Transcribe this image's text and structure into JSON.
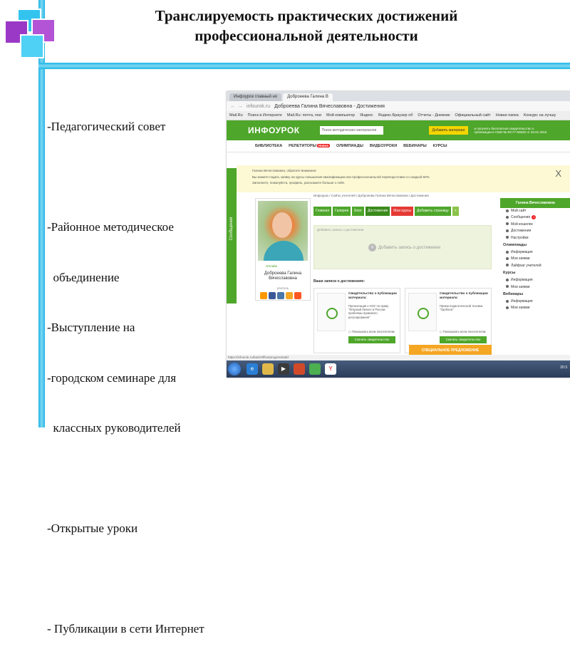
{
  "slide": {
    "title_line1": "Транслируемость практических достижений",
    "title_line2": "профессиональной деятельности",
    "bullets": [
      "-Педагогический совет",
      "",
      "-Районное методическое",
      "  объединение",
      "-Выступление на",
      "-городском семинаре для",
      "  классных руководителей",
      "",
      "-Открытые уроки",
      "",
      "- Публикации в сети Интернет"
    ]
  },
  "browser": {
    "tabs": [
      "Инфоурок главный но",
      "Доброеева Галина В"
    ],
    "url": "infourok.ru",
    "page_title": "Доброеева Галина Вячеславовна - Достижения",
    "bookmarks": [
      "Mail.Ru",
      "Поиск в Интернете",
      "Mail.Ru: почта, пои",
      "Мой компьютер",
      "Яндекс",
      "Яндекс.Браузер об",
      "Отчеты - Дневник",
      "Официальный сайт",
      "Новая папка",
      "Конкурс на лучшу"
    ]
  },
  "site": {
    "logo": "ИНФОУРОК",
    "search_placeholder": "Поиск методических материалов",
    "add_material_button": "Добавить материал",
    "promo_text": "и получить бесплатное свидетельство о публикации в СМИ № ФС77-60625 от 20.01.2015",
    "menu": [
      "БИБЛИОТЕКА",
      "РЕПЕТИТОРЫ",
      "ОЛИМПИАДЫ",
      "ВИДЕОУРОКИ",
      "ВЕБИНАРЫ",
      "КУРСЫ"
    ],
    "menu_badge": "Новое",
    "side_tab": "Сообщения",
    "notice_line1": "Галина Вячеславовна, обратите внимание:",
    "notice_line2": "Вы можете подать заявку на курсы повышения квалификации или профессиональной переподготовки со скидкой 50%",
    "notice_line3": "Заполните, пожалуйста, профиль, расскажите больше о себе.",
    "close": "X",
    "breadcrumb": "Инфоурок / Сайты учителей / Доброеева Галина Вячеславовна / Достижения",
    "profile": {
      "online": "Онлайн",
      "name": "Доброеева Галина Вячеславовна",
      "role": "учитель"
    },
    "page_buttons": [
      "Главная",
      "Галерея",
      "Блог",
      "Достижения",
      "Мои курсы",
      "Добавить страницу",
      "+"
    ],
    "add_label": "Добавить запись о достижении",
    "add_center": "Добавить запись о достижении",
    "section_title": "Ваши записи о достижениях:",
    "cards": [
      {
        "title": "Свидетельство о публикации материала:",
        "desc": "Презентация к НОУ по праву \"Игорный бизнес в России: проблемы правового регулирования\"",
        "show": "Показывать всем посетителям",
        "button": "Скачать свидетельство"
      },
      {
        "title": "Свидетельство о публикации материала:",
        "desc": "Прием педагогической техники \"Удобона\"",
        "show": "Показывать всем посетителям",
        "button": "Скачать свидетельство"
      }
    ],
    "special_offer": "СПЕЦИАЛЬНОЕ ПРЕДЛОЖЕНИЕ",
    "right_head": "Галина Вячеславовна",
    "right_items": [
      {
        "label": "Мой сайт"
      },
      {
        "label": "Сообщения",
        "badge": "1"
      },
      {
        "label": "Мой кошелек"
      },
      {
        "label": "Достижения"
      },
      {
        "label": "Настройки"
      }
    ],
    "right_sections": [
      {
        "title": "Олимпиады",
        "items": [
          "Информация",
          "Мои заявки",
          "Лайфхаг учителей"
        ]
      },
      {
        "title": "Курсы",
        "items": [
          "Информация",
          "Мои заявки"
        ]
      },
      {
        "title": "Вебинары",
        "items": [
          "Информация",
          "Мои заявки"
        ]
      }
    ],
    "status_url": "https://infourok.ru/backOffice/progress/add"
  },
  "taskbar": {
    "clock": "20:3"
  }
}
